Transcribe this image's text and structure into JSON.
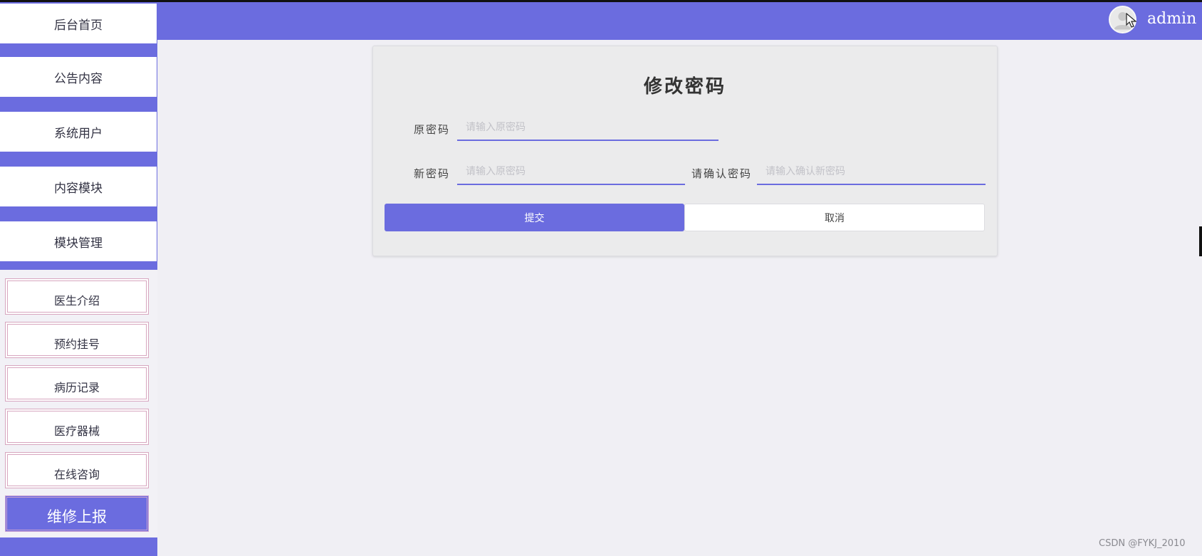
{
  "header": {
    "username": "admin",
    "avatar_icon": "user-avatar-icon",
    "bg_color": "#6b6cdf"
  },
  "sidebar": {
    "nav_items": [
      {
        "label": "后台首页"
      },
      {
        "label": "公告内容"
      },
      {
        "label": "系统用户"
      },
      {
        "label": "内容模块"
      },
      {
        "label": "模块管理"
      }
    ],
    "sub_items": [
      {
        "label": "医生介绍"
      },
      {
        "label": "预约挂号"
      },
      {
        "label": "病历记录"
      },
      {
        "label": "医疗器械"
      },
      {
        "label": "在线咨询"
      },
      {
        "label": "维修上报",
        "active": true
      }
    ]
  },
  "form": {
    "title": "修改密码",
    "old_password": {
      "label": "原密码",
      "placeholder": "请输入原密码",
      "value": ""
    },
    "new_password": {
      "label": "新密码",
      "placeholder": "请输入原密码",
      "value": ""
    },
    "confirm_password": {
      "label": "请确认密码",
      "placeholder": "请输入确认新密码",
      "value": ""
    },
    "submit_label": "提交",
    "cancel_label": "取消"
  },
  "watermark": "CSDN @FYKJ_2010",
  "colors": {
    "accent": "#6b6cdf",
    "background": "#f0eff4",
    "sub_item_border": "#d7a6bf"
  }
}
